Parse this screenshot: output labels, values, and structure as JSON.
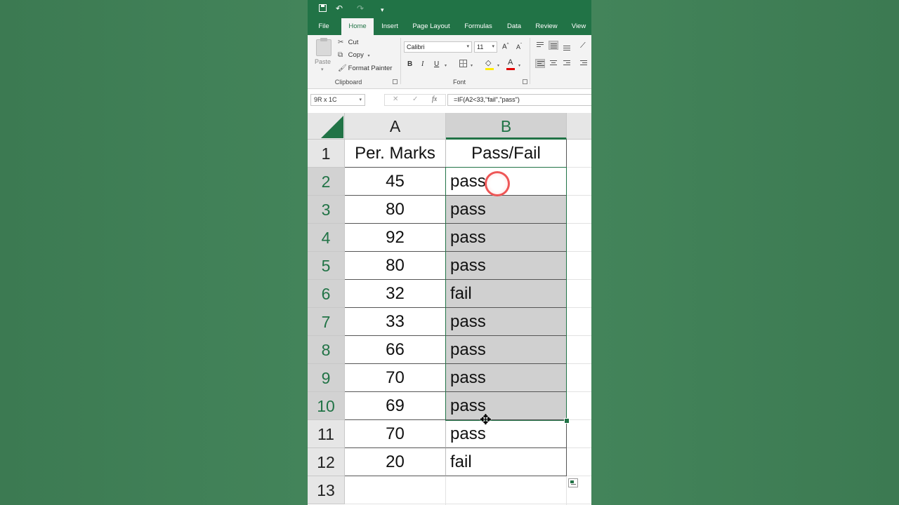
{
  "qat": {
    "undo_glyph": "↶",
    "redo_glyph": "↷",
    "more_glyph": "▾"
  },
  "tabs": [
    {
      "label": "File"
    },
    {
      "label": "Home"
    },
    {
      "label": "Insert"
    },
    {
      "label": "Page Layout"
    },
    {
      "label": "Formulas"
    },
    {
      "label": "Data"
    },
    {
      "label": "Review"
    },
    {
      "label": "View"
    }
  ],
  "active_tab": "Home",
  "ribbon": {
    "clipboard": {
      "paste_label": "Paste",
      "cut_label": "Cut",
      "copy_label": "Copy",
      "format_painter_label": "Format Painter",
      "group_label": "Clipboard"
    },
    "font": {
      "font_name": "Calibri",
      "font_size": "11",
      "grow_label": "A",
      "shrink_label": "A",
      "bold_label": "B",
      "italic_label": "I",
      "underline_label": "U",
      "font_color_label": "A",
      "group_label": "Font"
    }
  },
  "formula_bar": {
    "name_box": "9R x 1C",
    "cancel_glyph": "✕",
    "enter_glyph": "✓",
    "fx_label": "fx",
    "formula": "=IF(A2<33,\"fail\",\"pass\")"
  },
  "columns": [
    {
      "label": "A",
      "selected": false
    },
    {
      "label": "B",
      "selected": true
    }
  ],
  "rows": [
    {
      "num": "1",
      "a": "Per. Marks",
      "b": "Pass/Fail"
    },
    {
      "num": "2",
      "a": "45",
      "b": "pass"
    },
    {
      "num": "3",
      "a": "80",
      "b": "pass"
    },
    {
      "num": "4",
      "a": "92",
      "b": "pass"
    },
    {
      "num": "5",
      "a": "80",
      "b": "pass"
    },
    {
      "num": "6",
      "a": "32",
      "b": "fail"
    },
    {
      "num": "7",
      "a": "33",
      "b": "pass"
    },
    {
      "num": "8",
      "a": "66",
      "b": "pass"
    },
    {
      "num": "9",
      "a": "70",
      "b": "pass"
    },
    {
      "num": "10",
      "a": "69",
      "b": "pass"
    },
    {
      "num": "11",
      "a": "70",
      "b": "pass"
    },
    {
      "num": "12",
      "a": "20",
      "b": "fail"
    },
    {
      "num": "13",
      "a": "",
      "b": ""
    }
  ],
  "selection": {
    "range": "B2:B10"
  },
  "colors": {
    "accent": "#217346",
    "selection_fill": "#d0d0d0",
    "background": "#3f7d54"
  }
}
